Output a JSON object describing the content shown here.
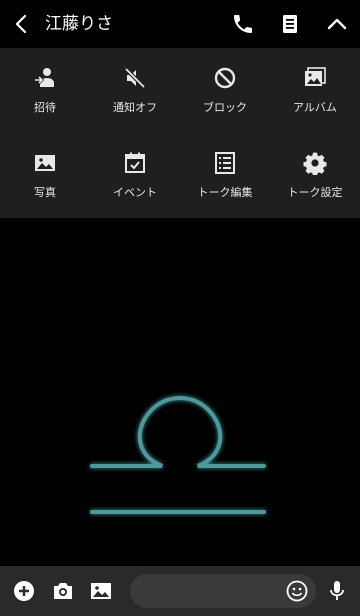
{
  "header": {
    "title": "江藤りさ",
    "icons": [
      "back-icon",
      "phone-icon",
      "notes-icon",
      "collapse-icon"
    ]
  },
  "menu": {
    "items": [
      {
        "label": "招待",
        "icon": "invite-icon"
      },
      {
        "label": "通知オフ",
        "icon": "mute-icon"
      },
      {
        "label": "ブロック",
        "icon": "block-icon"
      },
      {
        "label": "アルバム",
        "icon": "album-icon"
      },
      {
        "label": "写真",
        "icon": "photo-icon"
      },
      {
        "label": "イベント",
        "icon": "event-icon"
      },
      {
        "label": "トーク編集",
        "icon": "edit-list-icon"
      },
      {
        "label": "トーク設定",
        "icon": "gear-icon"
      }
    ]
  },
  "theme": {
    "accent": "#4a9a9b",
    "menu_bg": "#1f1f1f",
    "bottom_bg": "#2a2a2a"
  },
  "bottom": {
    "icons": [
      "plus-icon",
      "camera-icon",
      "image-icon",
      "emoji-icon",
      "mic-icon"
    ]
  }
}
